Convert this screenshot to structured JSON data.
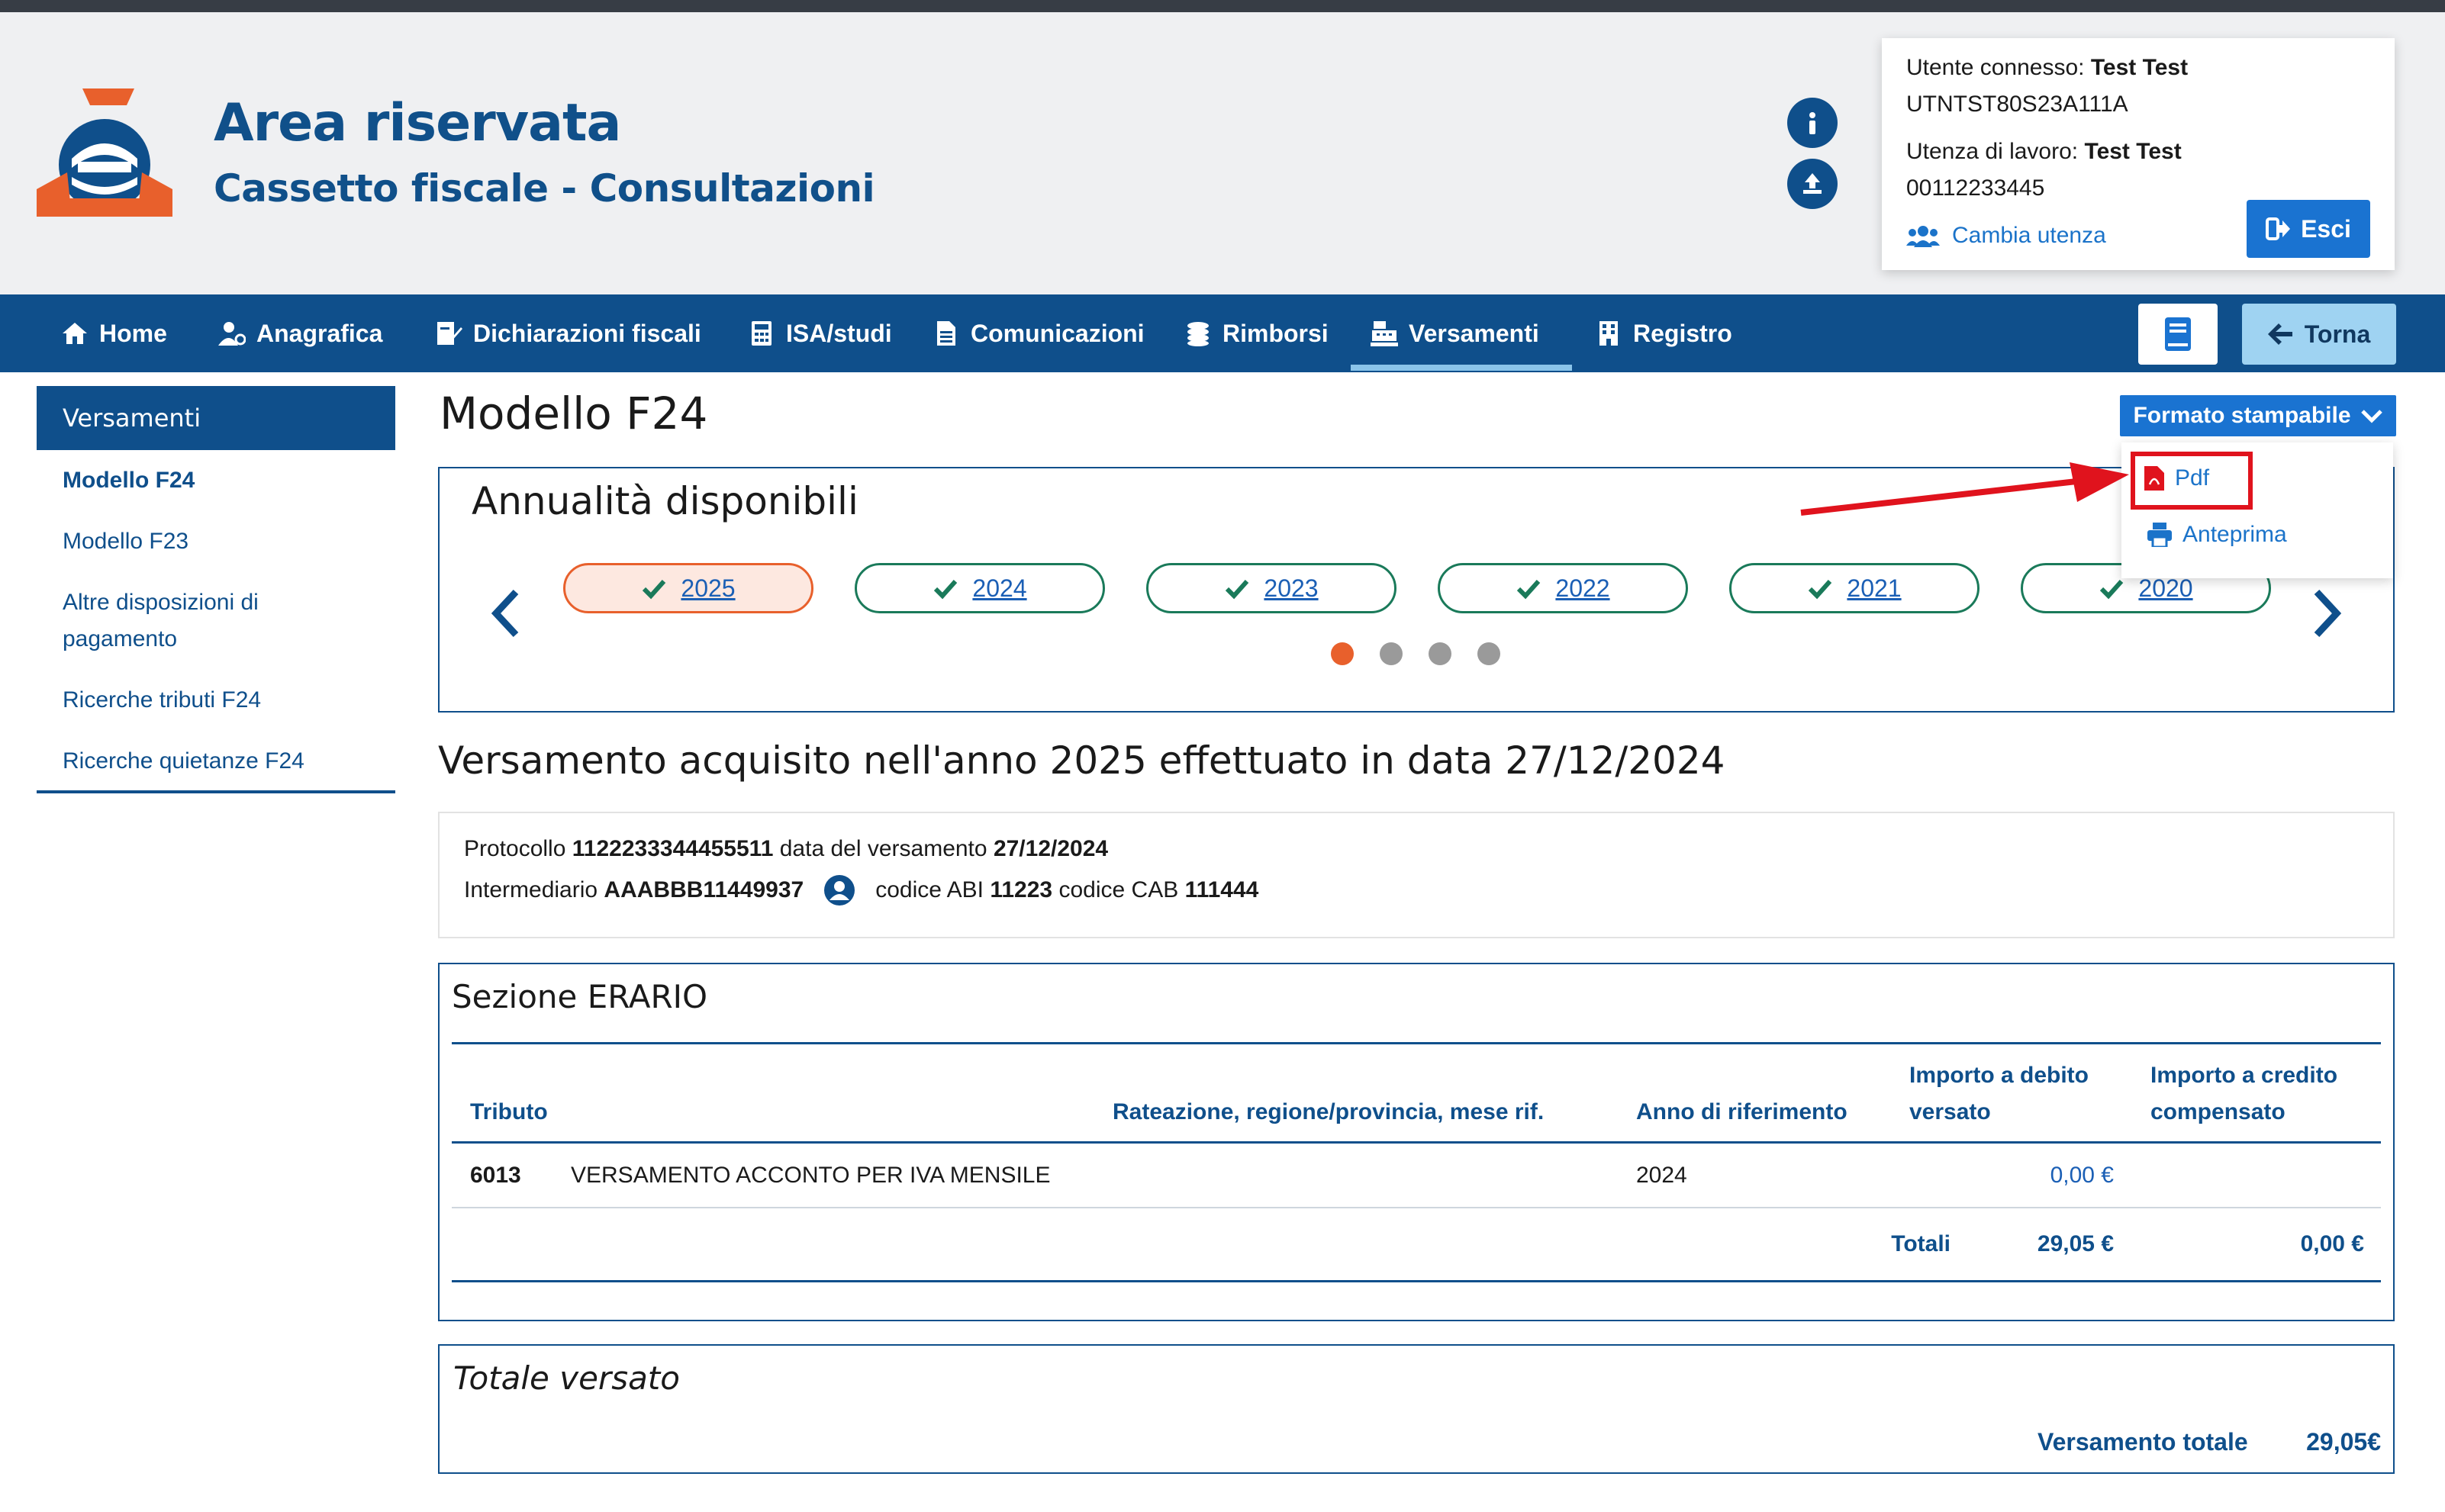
{
  "header": {
    "title": "Area riservata",
    "subtitle": "Cassetto fiscale - Consultazioni"
  },
  "user": {
    "connected_label": "Utente connesso:",
    "connected_name": "Test Test",
    "connected_code": "UTNTST80S23A111A",
    "work_label": "Utenza di lavoro:",
    "work_name": "Test Test",
    "work_code": "00112233445",
    "change_label": "Cambia utenza",
    "logout_label": "Esci"
  },
  "nav": {
    "items": [
      "Home",
      "Anagrafica",
      "Dichiarazioni fiscali",
      "ISA/studi",
      "Comunicazioni",
      "Rimborsi",
      "Versamenti",
      "Registro"
    ],
    "active": "Versamenti",
    "back_label": "Torna"
  },
  "sidebar": {
    "heading": "Versamenti",
    "items": [
      "Modello F24",
      "Modello F23",
      "Altre disposizioni di pagamento",
      "Ricerche tributi F24",
      "Ricerche quietanze F24"
    ],
    "active": "Modello F24"
  },
  "main": {
    "title": "Modello F24",
    "print_format_label": "Formato stampabile",
    "print_options": [
      "Pdf",
      "Anteprima"
    ],
    "years_title": "Annualità disponibili",
    "years": [
      "2025",
      "2024",
      "2023",
      "2022",
      "2021",
      "2020"
    ],
    "selected_year": "2025",
    "carousel_pages": 4,
    "carousel_active": 1,
    "payment_title": "Versamento acquisito nell'anno 2025 effettuato in data 27/12/2024",
    "protocol_label": "Protocollo",
    "protocol_value": "1122233344455511",
    "date_label": "data del versamento",
    "date_value": "27/12/2024",
    "intermediary_label": "Intermediario",
    "intermediary_value": "AAABBB11449937",
    "abi_label": "codice ABI",
    "abi_value": "11223",
    "cab_label": "codice CAB",
    "cab_value": "111444"
  },
  "erario": {
    "title": "Sezione ERARIO",
    "headers": {
      "tributo": "Tributo",
      "rateazione": "Rateazione, regione/provincia, mese rif.",
      "anno": "Anno di riferimento",
      "debito_1": "Importo a debito",
      "debito_2": "versato",
      "credito_1": "Importo a credito",
      "credito_2": "compensato"
    },
    "rows": [
      {
        "code": "6013",
        "description": "VERSAMENTO ACCONTO PER IVA MENSILE",
        "rateazione": "",
        "anno": "2024",
        "debito": "0,00 €",
        "credito": ""
      }
    ],
    "totals_label": "Totali",
    "totals_debito": "29,05 €",
    "totals_credito": "0,00 €"
  },
  "totale": {
    "title": "Totale versato",
    "label": "Versamento totale",
    "value": "29,05€"
  },
  "colors": {
    "primary": "#0f4f8b",
    "button": "#1a73d1",
    "accent": "#e8602c",
    "highlight": "#e0131d",
    "pill_border": "#1a7a5a"
  }
}
